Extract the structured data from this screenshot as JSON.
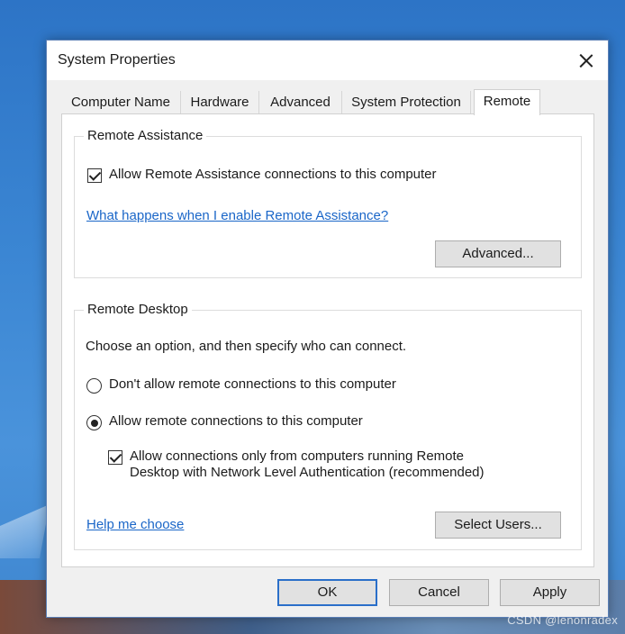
{
  "window": {
    "title": "System Properties"
  },
  "tabs": [
    {
      "label": "Computer Name",
      "active": false
    },
    {
      "label": "Hardware",
      "active": false
    },
    {
      "label": "Advanced",
      "active": false
    },
    {
      "label": "System Protection",
      "active": false
    },
    {
      "label": "Remote",
      "active": true
    }
  ],
  "remote_assistance": {
    "group_label": "Remote Assistance",
    "allow_label": "Allow Remote Assistance connections to this computer",
    "allow_checked": true,
    "help_link": "What happens when I enable Remote Assistance?",
    "advanced_button": "Advanced..."
  },
  "remote_desktop": {
    "group_label": "Remote Desktop",
    "instruction": "Choose an option, and then specify who can connect.",
    "option_dont_allow": "Don't allow remote connections to this computer",
    "option_allow": "Allow remote connections to this computer",
    "selected_option": "allow",
    "nla_label_line1": "Allow connections only from computers running Remote",
    "nla_label_line2": "Desktop with Network Level Authentication (recommended)",
    "nla_checked": true,
    "help_link": "Help me choose",
    "select_users_button": "Select Users..."
  },
  "footer": {
    "ok": "OK",
    "cancel": "Cancel",
    "apply": "Apply"
  },
  "watermark": "CSDN @lenonradex"
}
